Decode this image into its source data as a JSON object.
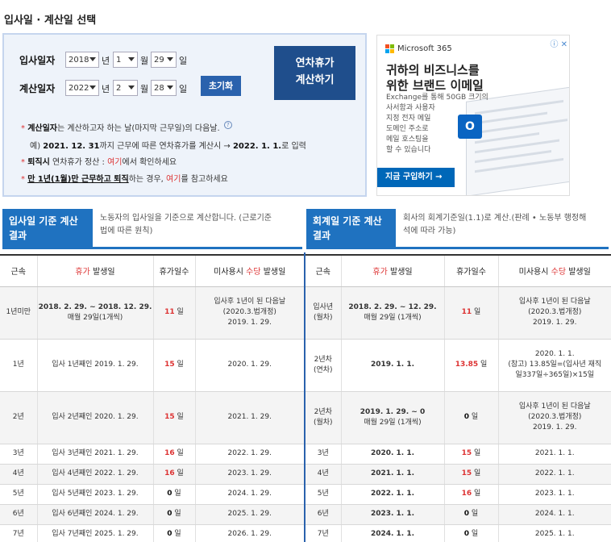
{
  "page_title": "입사일 · 계산일 선택",
  "form": {
    "hire_label": "입사일자",
    "calc_label": "계산일자",
    "hire": {
      "year": "2018",
      "month": "1",
      "day": "29"
    },
    "calc": {
      "year": "2022",
      "month": "2",
      "day": "28"
    },
    "unit_year": "년",
    "unit_month": "월",
    "unit_day": "일",
    "calc_button_line1": "연차휴가",
    "calc_button_line2": "계산하기",
    "reset_button": "초기화",
    "notes": {
      "n1_a": "계산일자",
      "n1_b": "는 계산하고자 하는 날(마지막 근무일)의 다음날.",
      "n2_a": "예) ",
      "n2_b": "2021. 12. 31",
      "n2_c": "까지 근무에 따른 연차휴가를 계산시 → ",
      "n2_d": "2022. 1. 1.",
      "n2_e": "로 입력",
      "n3_a": "퇴직시",
      "n3_b": " 연차휴가 정산 : ",
      "n3_c": "여기",
      "n3_d": "에서 확인하세요",
      "n4_a": "만 1년(1월)만 근무하고 퇴직",
      "n4_b": "하는 경우, ",
      "n4_c": "여기",
      "n4_d": "를 참고하세요",
      "help": "?"
    }
  },
  "ad": {
    "brand": "Microsoft 365",
    "close": "ⓘ ✕",
    "headline_1": "귀하의 비즈니스를",
    "headline_2": "위한 브랜드 이메일",
    "body_1": "Exchange를 통해 50GB 크기의",
    "body_2": "사서함과 사용자",
    "body_3": "지정 전자 메일",
    "body_4": "도메인 주소로",
    "body_5": "메일 호스팅을",
    "body_6": "할 수 있습니다",
    "cta": "지금 구입하기 →",
    "outlook_letter": "O",
    "colors": {
      "red": "#f25022",
      "green": "#7fba00",
      "blue": "#00a4ef",
      "yellow": "#ffb900"
    }
  },
  "tabs": {
    "hire_tab_1": "입사일 기준 계산",
    "hire_tab_2": "결과",
    "hire_desc_1": "노동자의 입사일을 기준으로 계산합니다. (근로기준",
    "hire_desc_2": "법에 따른 원칙)",
    "fiscal_tab_1": "회계일 기준 계산",
    "fiscal_tab_2": "결과",
    "fiscal_desc_1": "회사의 회계기준일(1.1)로 계산.(판례 • 노동부 행정해",
    "fiscal_desc_2": "석에 따라 가능)"
  },
  "left_table": {
    "headers": {
      "tenure": "근속",
      "occur_a": "휴가",
      "occur_b": " 발생일",
      "days": "휴가일수",
      "unused_a": "미사용시 ",
      "unused_b": "수당",
      "unused_c": " 발생일"
    },
    "rows": [
      {
        "tenure": "1년미만",
        "occur_1": "2018. 2. 29.   ~  2018. 12. 29.",
        "occur_2": "매월 29일(1개씩)",
        "days": "11",
        "unused_1": "입사후 1년이 된 다음날",
        "unused_2": "(2020.3.법개정)",
        "unused_3": "2019. 1. 29."
      },
      {
        "tenure": "1년",
        "occur_1": "입사 1년째인 2019. 1. 29.",
        "days": "15",
        "unused_1": "2020. 1. 29."
      },
      {
        "tenure": "2년",
        "occur_1": "입사 2년째인 2020. 1. 29.",
        "days": "15",
        "unused_1": "2021. 1. 29."
      },
      {
        "tenure": "3년",
        "occur_1": "입사 3년째인 2021. 1. 29.",
        "days": "16",
        "unused_1": "2022. 1. 29."
      },
      {
        "tenure": "4년",
        "occur_1": "입사 4년째인 2022. 1. 29.",
        "days": "16",
        "unused_1": "2023. 1. 29."
      },
      {
        "tenure": "5년",
        "occur_1": "입사 5년째인 2023. 1. 29.",
        "days": "0",
        "unused_1": "2024. 1. 29."
      },
      {
        "tenure": "6년",
        "occur_1": "입사 6년째인 2024. 1. 29.",
        "days": "0",
        "unused_1": "2025. 1. 29."
      },
      {
        "tenure": "7년",
        "occur_1": "입사 7년째인 2025. 1. 29.",
        "days": "0",
        "unused_1": "2026. 1. 29."
      }
    ],
    "day_unit": " 일"
  },
  "right_table": {
    "rows": [
      {
        "tenure_1": "입사년",
        "tenure_2": "(월차)",
        "occur_1": "2018. 2. 29.   ~  12. 29.",
        "occur_2": "매월 29일 (1개씩)",
        "days": "11",
        "unused_1": "입사후 1년이 된 다음날",
        "unused_2": "(2020.3.법개정)",
        "unused_3": "2019. 1. 29."
      },
      {
        "tenure_1": "2년차",
        "tenure_2": "(연차)",
        "occur_1": "2019. 1. 1.",
        "days": "13.85",
        "unused_1": "2020. 1. 1.",
        "unused_2": "(참고) 13.85일=(입사년 재직",
        "unused_3": "일337일÷365일)×15일"
      },
      {
        "tenure_1": "2년차",
        "tenure_2": "(월차)",
        "occur_1": "2019. 1. 29.   ~    0",
        "occur_2": "매월 29일 (1개씩)",
        "days": "0",
        "unused_1": "입사후 1년이 된 다음날",
        "unused_2": "(2020.3.법개정)",
        "unused_3": "2019. 1. 29."
      },
      {
        "tenure_1": "3년",
        "occur_1": "2020. 1. 1.",
        "days": "15",
        "unused_1": "2021. 1. 1."
      },
      {
        "tenure_1": "4년",
        "occur_1": "2021. 1. 1.",
        "days": "15",
        "unused_1": "2022. 1. 1."
      },
      {
        "tenure_1": "5년",
        "occur_1": "2022. 1. 1.",
        "days": "16",
        "unused_1": "2023. 1. 1."
      },
      {
        "tenure_1": "6년",
        "occur_1": "2023. 1. 1.",
        "days": "0",
        "unused_1": "2024. 1. 1."
      },
      {
        "tenure_1": "7년",
        "occur_1": "2024. 1. 1.",
        "days": "0",
        "unused_1": "2025. 1. 1."
      }
    ]
  },
  "colors": {
    "accent": "#1f72c0",
    "dark_button": "#1f4e8c",
    "red": "#dd3333"
  }
}
